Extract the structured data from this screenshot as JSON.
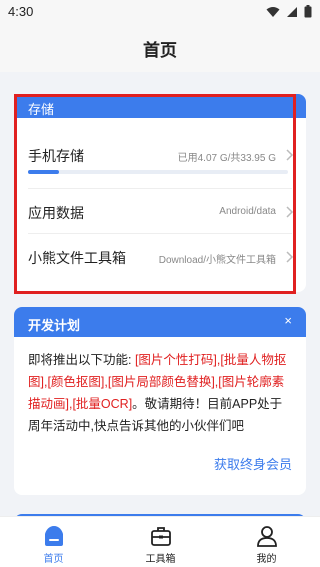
{
  "status_bar": {
    "time": "4:30"
  },
  "header": {
    "title": "首页"
  },
  "storage": {
    "title": "存储",
    "phone": {
      "label": "手机存储",
      "value": "已用4.07 G/共33.95 G",
      "used_fraction": 0.12
    },
    "app_data": {
      "label": "应用数据",
      "value": "Android/data"
    },
    "toolbox": {
      "label": "小熊文件工具箱",
      "value": "Download/小熊文件工具箱"
    }
  },
  "plan": {
    "title": "开发计划",
    "close": "×",
    "intro": "即将推出以下功能: ",
    "features": "[图片个性打码],[批量人物抠图],[颜色抠图],[图片局部颜色替换],[图片轮廓素描动画],[批量OCR]",
    "outro": "。敬请期待！目前APP处于周年活动中,快点告诉其他的小伙伴们吧",
    "link": "获取终身会员"
  },
  "nav": {
    "home": "首页",
    "toolbox": "工具箱",
    "mine": "我的"
  },
  "colors": {
    "accent": "#3c7cec",
    "highlight": "#e02020",
    "inactive": "#222222"
  },
  "icons": [
    "wifi-icon",
    "signal-icon",
    "battery-icon",
    "chevron-right-icon",
    "close-icon",
    "home-icon",
    "toolbox-icon",
    "user-icon"
  ]
}
